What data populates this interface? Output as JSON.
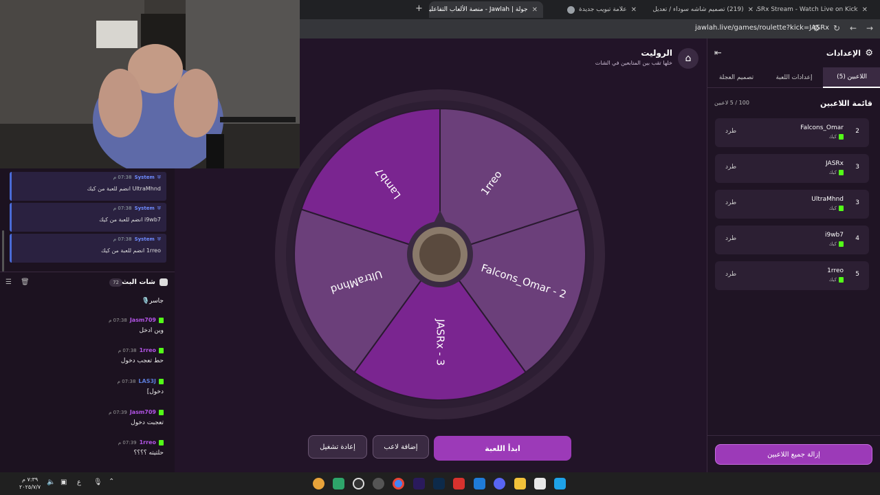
{
  "browser": {
    "tabs": [
      {
        "title": "JASRx Stream - Watch Live on Kick",
        "color": "#53fc18",
        "active": false
      },
      {
        "title": "(219) تصميم شاشه سوداء / تعديل",
        "color": "#ff0000",
        "active": false
      },
      {
        "title": "علامة تبويب جديدة",
        "color": "#9aa0a6",
        "active": false
      },
      {
        "title": "جولة | Jawlah - منصة الألعاب التفاعلية",
        "color": "#c8c8c8",
        "active": true
      }
    ],
    "new_tab": "+",
    "url": "jawlah.live/games/roulette?kick=JASRx"
  },
  "chat": {
    "system_messages": [
      {
        "name": "System",
        "time": "07:38 م",
        "text": "UltraMhnd انضم للعبة من كيك"
      },
      {
        "name": "System",
        "time": "07:38 م",
        "text": "i9wb7 انضم للعبة من كيك"
      },
      {
        "name": "System",
        "time": "07:38 م",
        "text": "1rreo انضم للعبة من كيك"
      }
    ],
    "title": "شات البث",
    "count": "72",
    "first_line": "جاسر🎙️",
    "messages": [
      {
        "name": "Jasm709",
        "time": "07:38 م",
        "text": "وين ادخل",
        "color": "#b455e8"
      },
      {
        "name": "1rreo",
        "time": "07:38 م",
        "text": "حط تعجب دخول",
        "color": "#b455e8"
      },
      {
        "name": "LAS3J",
        "time": "07:38 م",
        "text": "دخول]",
        "color": "#5b7bd8"
      },
      {
        "name": "Jasm709",
        "time": "07:39 م",
        "text": "تعجبت دخول",
        "color": "#b455e8"
      },
      {
        "name": "1rreo",
        "time": "07:39 م",
        "text": "حلتيته ؟؟؟؟",
        "color": "#b455e8"
      }
    ]
  },
  "game": {
    "title": "الروليت",
    "subtitle": "خلها تقب بين المتابعين في الشات",
    "wheel_segments": [
      {
        "label": "Falcons_Omar - 2",
        "color": "#6b3f7a"
      },
      {
        "label": "JASRx - 3",
        "color": "#7a2590"
      },
      {
        "label": "UltraMhnd",
        "color": "#6b3f7a"
      },
      {
        "label": "Lamb7",
        "color": "#7a2590"
      },
      {
        "label": "1rreo",
        "color": "#6b3f7a"
      }
    ],
    "buttons": {
      "start": "ابدأ اللعبة",
      "add_player": "إضافة لاعب",
      "restart": "إعادة تشغيل"
    }
  },
  "settings": {
    "title": "الإعدادات",
    "tabs": [
      "اللاعبين (5)",
      "إعدادات اللعبة",
      "تصميم العجلة"
    ],
    "list_title": "قائمة اللاعبين",
    "list_count": "100 / 5 لاعبين",
    "players": [
      {
        "name": "Falcons_Omar",
        "num": "2",
        "source": "كيك",
        "action": "طرد"
      },
      {
        "name": "JASRx",
        "num": "3",
        "source": "كيك",
        "action": "طرد"
      },
      {
        "name": "UltraMhnd",
        "num": "3",
        "source": "كيك",
        "action": "طرد"
      },
      {
        "name": "i9wb7",
        "num": "4",
        "source": "كيك",
        "action": "طرد"
      },
      {
        "name": "1rreo",
        "num": "5",
        "source": "كيك",
        "action": "طرد"
      }
    ],
    "remove_all": "إزالة جميع اللاعبين"
  },
  "taskbar": {
    "time": "٧:٣٩ م",
    "date": "٢٠٢٥/٧/٧",
    "lang": "ع"
  }
}
